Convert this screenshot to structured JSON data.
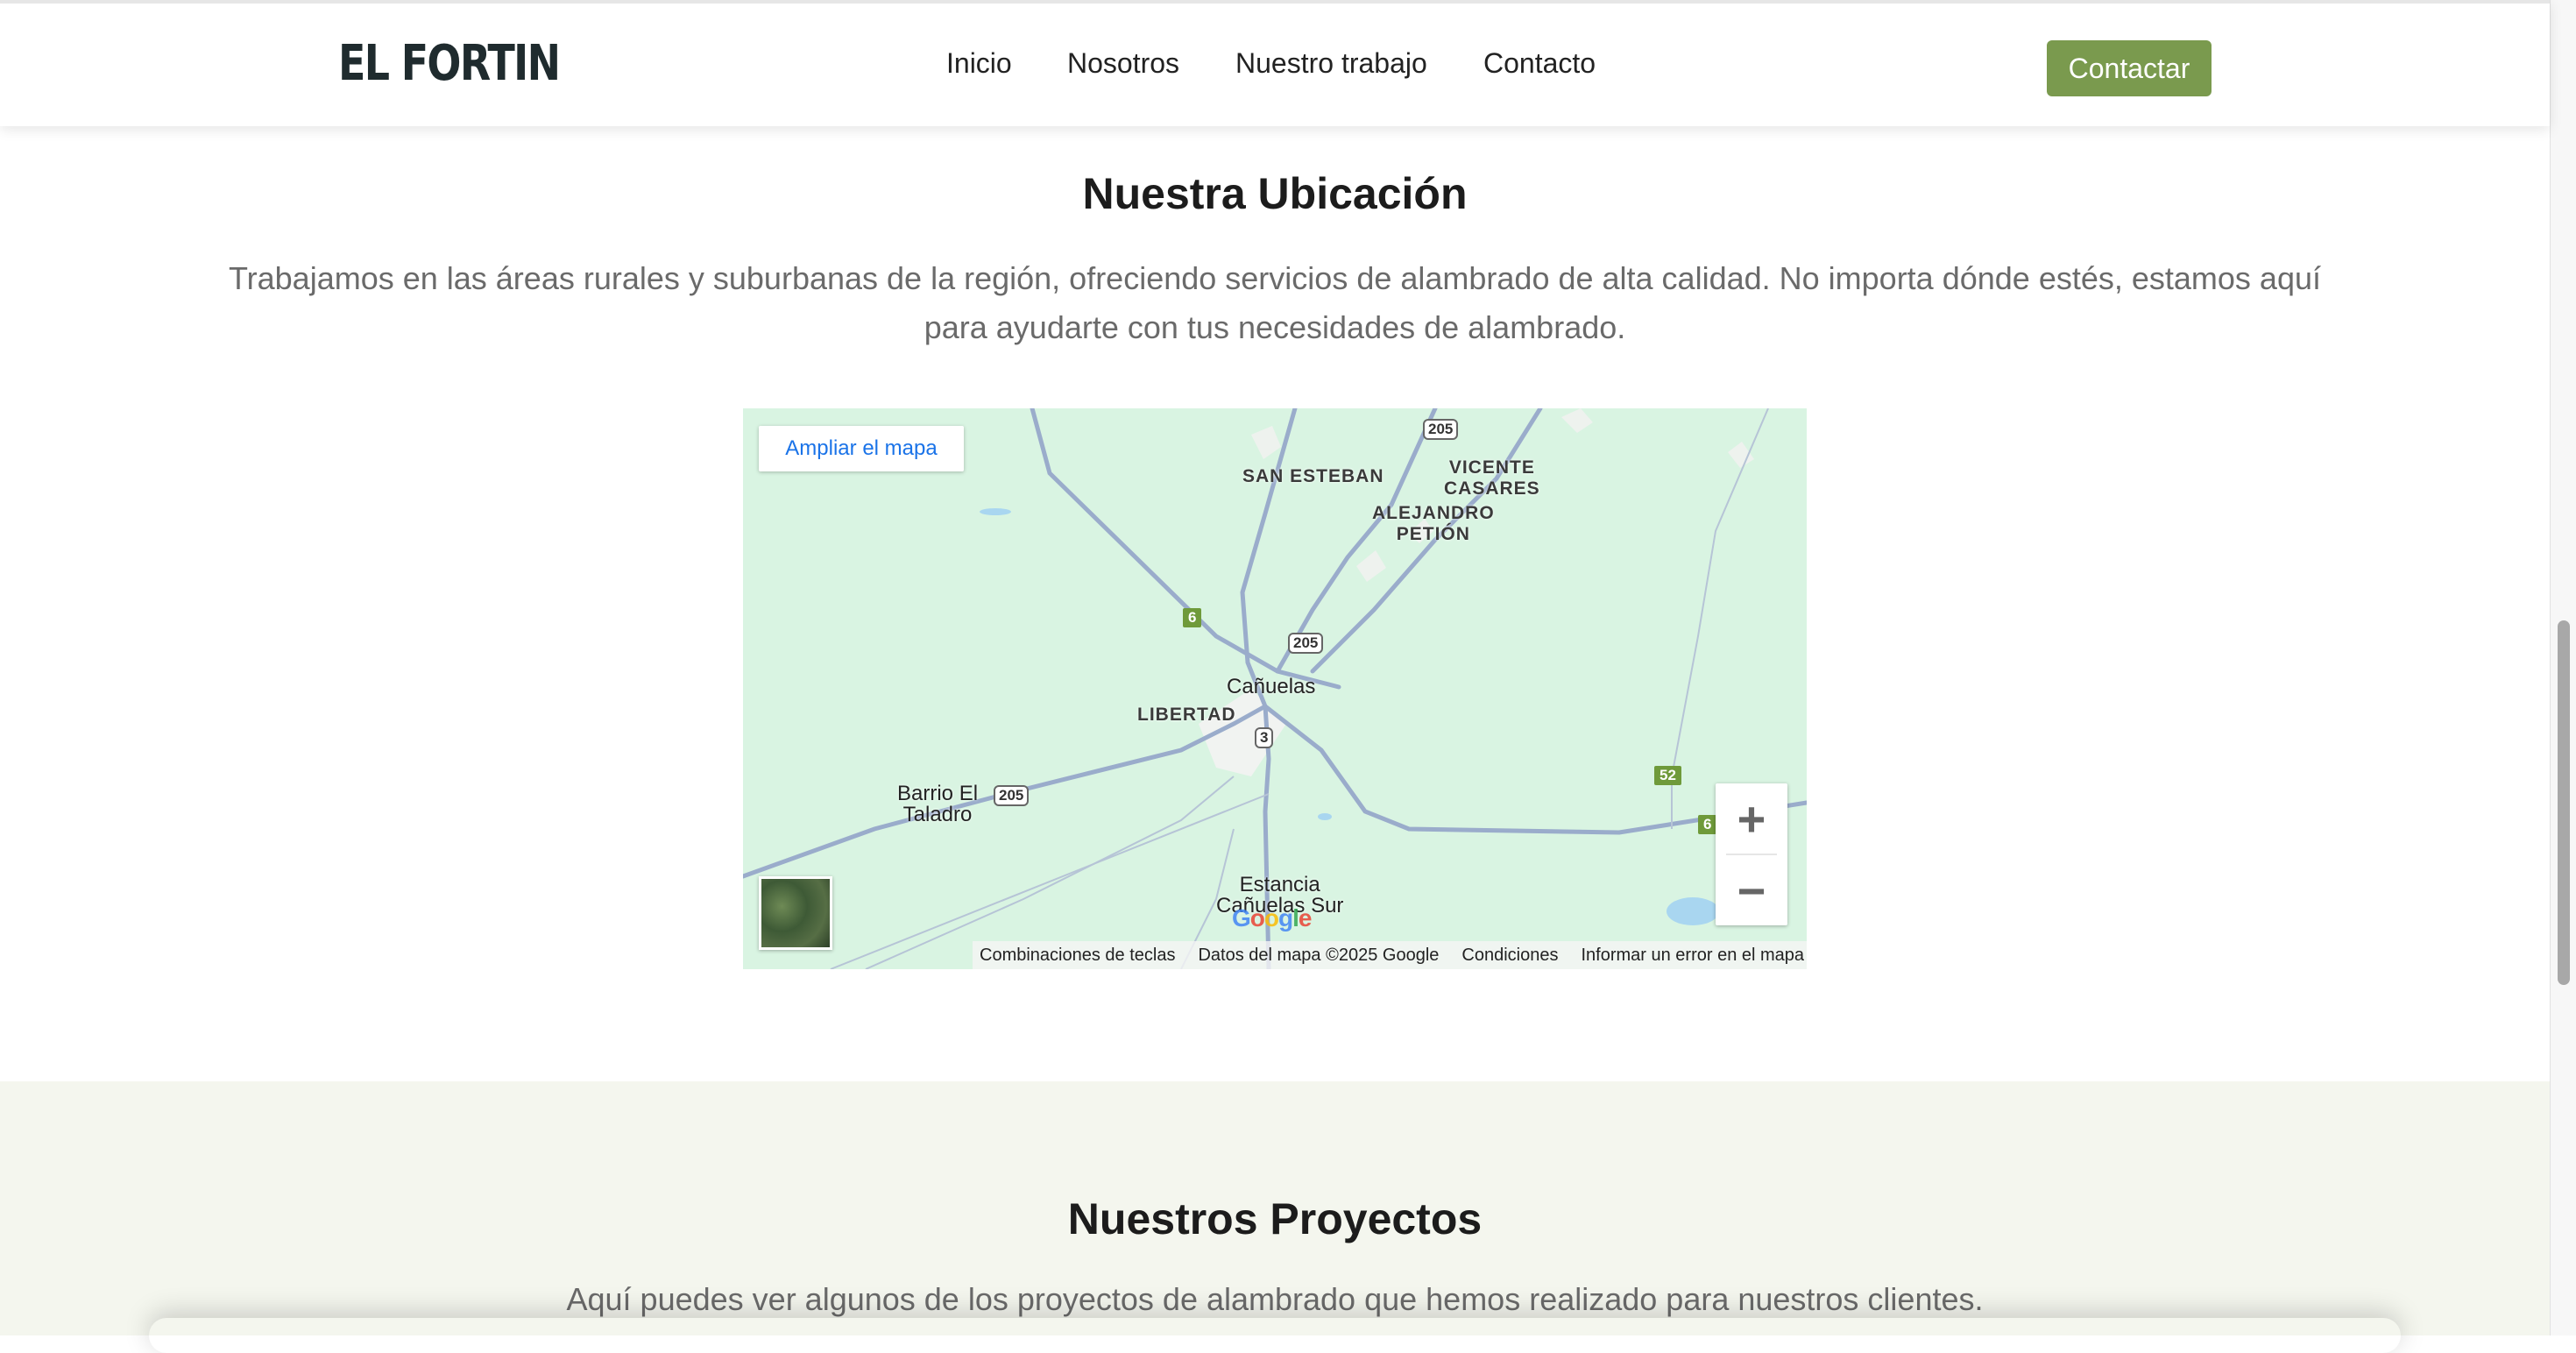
{
  "brand": "EL FORTIN",
  "nav": {
    "links": [
      "Inicio",
      "Nosotros",
      "Nuestro trabajo",
      "Contacto"
    ],
    "cta": "Contactar"
  },
  "location": {
    "title": "Nuestra Ubicación",
    "description": "Trabajamos en las áreas rurales y suburbanas de la región, ofreciendo servicios de alambrado de alta calidad. No importa dónde estés, estamos aquí para ayudarte con tus necesidades de alambrado."
  },
  "map": {
    "expand_label": "Ampliar el mapa",
    "places": {
      "san_esteban": "SAN ESTEBAN",
      "vicente_casares": "VICENTE\nCASARES",
      "alejandro_petion": "ALEJANDRO\nPETIÓN",
      "canuelas": "Cañuelas",
      "libertad": "LIBERTAD",
      "barrio_el_taladro": "Barrio El\nTaladro",
      "estancia_canuelas_sur": "Estancia\nCañuelas Sur"
    },
    "routes": {
      "r205_top": "205",
      "r205_mid": "205",
      "r205_left": "205",
      "r3": "3",
      "r6_left": "6",
      "r6_right": "6",
      "r52": "52"
    },
    "zoom_in": "+",
    "zoom_out": "−",
    "google": "Google",
    "footer": {
      "shortcuts": "Combinaciones de teclas",
      "data": "Datos del mapa ©2025 Google",
      "terms": "Condiciones",
      "report": "Informar un error en el mapa"
    },
    "colors": {
      "land": "#d9f4e2",
      "road": "#9aaccb"
    }
  },
  "projects": {
    "title": "Nuestros Proyectos",
    "description": "Aquí puedes ver algunos de los proyectos de alambrado que hemos realizado para nuestros clientes."
  },
  "colors": {
    "accent": "#7a9a4e",
    "projects_bg": "#f4f6ee"
  }
}
